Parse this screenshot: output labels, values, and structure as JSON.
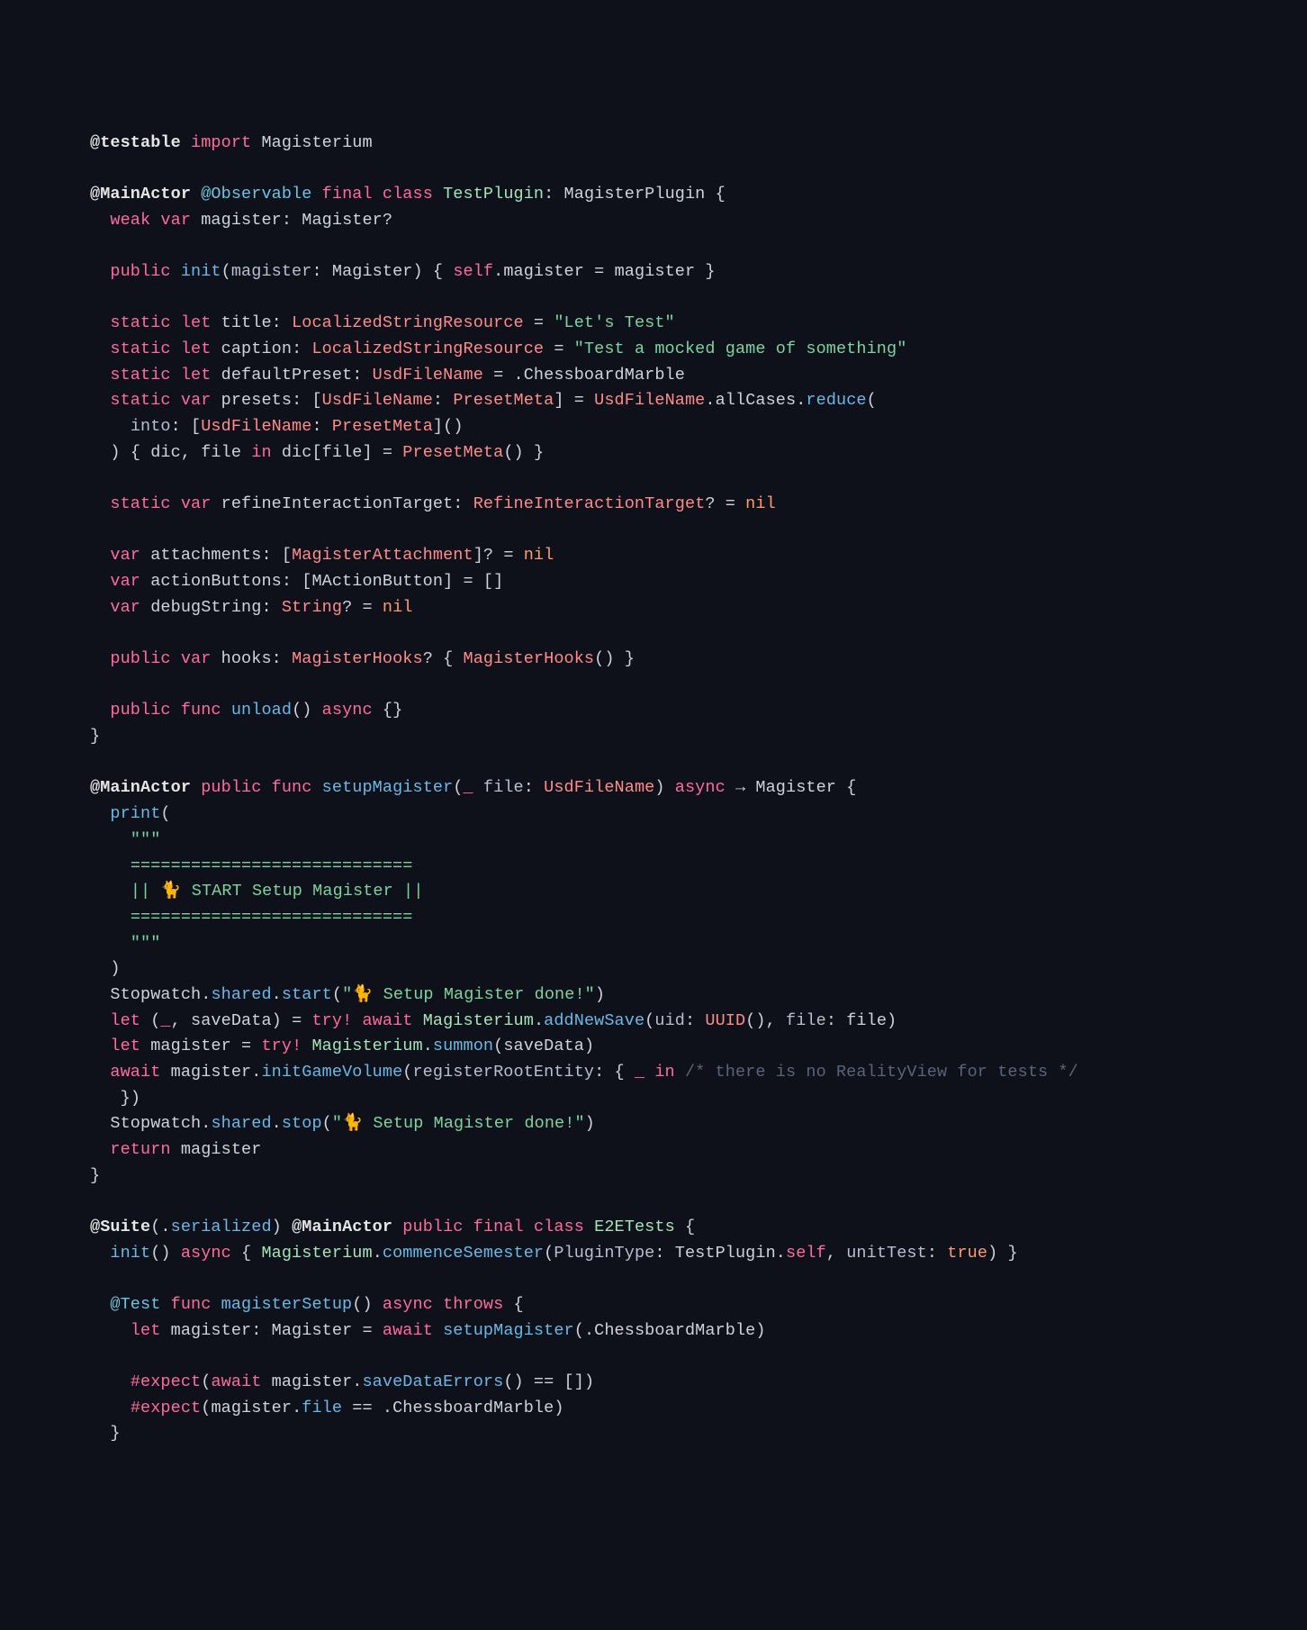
{
  "code": {
    "l1": {
      "a": "@testable",
      "b": "import",
      "c": "Magisterium"
    },
    "l2": {
      "a": "@MainActor",
      "b": "@Observable",
      "c": "final",
      "d": "class",
      "e": "TestPlugin",
      "f": ":",
      "g": "MagisterPlugin",
      "h": "{"
    },
    "l3": {
      "a": "weak",
      "b": "var",
      "c": "magister",
      "d": ":",
      "e": "Magister",
      "f": "?"
    },
    "l4": {
      "a": "public",
      "b": "init",
      "c": "(",
      "d": "magister",
      "e": ":",
      "f": "Magister",
      "g": ")",
      "h": "{",
      "i": "self",
      "j": ".",
      "k": "magister",
      "l": "=",
      "m": "magister",
      "n": "}"
    },
    "l5": {
      "a": "static",
      "b": "let",
      "c": "title",
      "d": ":",
      "e": "LocalizedStringResource",
      "f": "=",
      "g": "\"Let's Test\""
    },
    "l6": {
      "a": "static",
      "b": "let",
      "c": "caption",
      "d": ":",
      "e": "LocalizedStringResource",
      "f": "=",
      "g": "\"Test a mocked game of something\""
    },
    "l7": {
      "a": "static",
      "b": "let",
      "c": "defaultPreset",
      "d": ":",
      "e": "UsdFileName",
      "f": "=",
      "g": ".",
      "h": "ChessboardMarble"
    },
    "l8": {
      "a": "static",
      "b": "var",
      "c": "presets",
      "d": ":",
      "e": "[",
      "f": "UsdFileName",
      "g": ":",
      "h": "PresetMeta",
      "i": "]",
      "j": "=",
      "k": "UsdFileName",
      "l": ".",
      "m": "allCases",
      "n": ".",
      "o": "reduce",
      "p": "("
    },
    "l9": {
      "a": "into",
      "b": ":",
      "c": "[",
      "d": "UsdFileName",
      "e": ":",
      "f": "PresetMeta",
      "g": "]",
      "h": "(",
      "i": ")"
    },
    "l10": {
      "a": ")",
      "b": "{",
      "c": "dic",
      "d": ",",
      "e": "file",
      "f": "in",
      "g": "dic",
      "h": "[",
      "i": "file",
      "j": "]",
      "k": "=",
      "l": "PresetMeta",
      "m": "(",
      "n": ")",
      "o": "}"
    },
    "l11": {
      "a": "static",
      "b": "var",
      "c": "refineInteractionTarget",
      "d": ":",
      "e": "RefineInteractionTarget",
      "f": "?",
      "g": "=",
      "h": "nil"
    },
    "l12": {
      "a": "var",
      "b": "attachments",
      "c": ":",
      "d": "[",
      "e": "MagisterAttachment",
      "f": "]",
      "g": "?",
      "h": "=",
      "i": "nil"
    },
    "l13": {
      "a": "var",
      "b": "actionButtons",
      "c": ":",
      "d": "[",
      "e": "MActionButton",
      "f": "]",
      "g": "=",
      "h": "[",
      "i": "]"
    },
    "l14": {
      "a": "var",
      "b": "debugString",
      "c": ":",
      "d": "String",
      "e": "?",
      "f": "=",
      "g": "nil"
    },
    "l15": {
      "a": "public",
      "b": "var",
      "c": "hooks",
      "d": ":",
      "e": "MagisterHooks",
      "f": "?",
      "g": "{",
      "h": "MagisterHooks",
      "i": "(",
      "j": ")",
      "k": "}"
    },
    "l16": {
      "a": "public",
      "b": "func",
      "c": "unload",
      "d": "(",
      "e": ")",
      "f": "async",
      "g": "{",
      "h": "}"
    },
    "l17": {
      "a": "}"
    },
    "l18": {
      "a": "@MainActor",
      "b": "public",
      "c": "func",
      "d": "setupMagister",
      "e": "(",
      "f": "_",
      "g": "file",
      "h": ":",
      "i": "UsdFileName",
      "j": ")",
      "k": "async",
      "l": "→",
      "m": "Magister",
      "n": "{"
    },
    "l19": {
      "a": "print",
      "b": "("
    },
    "l20": {
      "a": "\"\"\""
    },
    "l21": {
      "a": "============================"
    },
    "l22": {
      "a": "||",
      "b": "🐈",
      "c": "START Setup Magister",
      "d": "||"
    },
    "l23": {
      "a": "============================"
    },
    "l24": {
      "a": "\"\"\""
    },
    "l25": {
      "a": ")"
    },
    "l26": {
      "a": "Stopwatch",
      "b": ".",
      "c": "shared",
      "d": ".",
      "e": "start",
      "f": "(",
      "g": "\"🐈 Setup Magister done!\"",
      "h": ")"
    },
    "l27": {
      "a": "let",
      "b": "(",
      "c": "_",
      "d": ",",
      "e": "saveData",
      "f": ")",
      "g": "=",
      "h": "try",
      "i": "!",
      "j": "await",
      "k": "Magisterium",
      "l": ".",
      "m": "addNewSave",
      "n": "(",
      "o": "uid",
      "p": ":",
      "q": "UUID",
      "r": "(",
      "s": ")",
      "t": ",",
      "u": "file",
      "v": ":",
      "w": "file",
      "x": ")"
    },
    "l28": {
      "a": "let",
      "b": "magister",
      "c": "=",
      "d": "try",
      "e": "!",
      "f": "Magisterium",
      "g": ".",
      "h": "summon",
      "i": "(",
      "j": "saveData",
      "k": ")"
    },
    "l29": {
      "a": "await",
      "b": "magister",
      "c": ".",
      "d": "initGameVolume",
      "e": "(",
      "f": "registerRootEntity",
      "g": ":",
      "h": "{",
      "i": "_",
      "j": "in",
      "k": "/* there is no RealityView for tests */"
    },
    "l30": {
      "a": "}",
      "b": ")"
    },
    "l31": {
      "a": "Stopwatch",
      "b": ".",
      "c": "shared",
      "d": ".",
      "e": "stop",
      "f": "(",
      "g": "\"🐈 Setup Magister done!\"",
      "h": ")"
    },
    "l32": {
      "a": "return",
      "b": "magister"
    },
    "l33": {
      "a": "}"
    },
    "l34": {
      "a": "@Suite",
      "b": "(",
      "c": ".",
      "d": "serialized",
      "e": ")",
      "f": "@MainActor",
      "g": "public",
      "h": "final",
      "i": "class",
      "j": "E2ETests",
      "k": "{"
    },
    "l35": {
      "a": "init",
      "b": "(",
      "c": ")",
      "d": "async",
      "e": "{",
      "f": "Magisterium",
      "g": ".",
      "h": "commenceSemester",
      "i": "(",
      "j": "PluginType",
      "k": ":",
      "l": "TestPlugin",
      "m": ".",
      "n": "self",
      "o": ",",
      "p": "unitTest",
      "q": ":",
      "r": "true",
      "s": ")",
      "t": "}"
    },
    "l36": {
      "a": "@Test",
      "b": "func",
      "c": "magisterSetup",
      "d": "(",
      "e": ")",
      "f": "async",
      "g": "throws",
      "h": "{"
    },
    "l37": {
      "a": "let",
      "b": "magister",
      "c": ":",
      "d": "Magister",
      "e": "=",
      "f": "await",
      "g": "setupMagister",
      "h": "(",
      "i": ".",
      "j": "ChessboardMarble",
      "k": ")"
    },
    "l38": {
      "a": "#expect",
      "b": "(",
      "c": "await",
      "d": "magister",
      "e": ".",
      "f": "saveDataErrors",
      "g": "(",
      "h": ")",
      "i": "==",
      "j": "[",
      "k": "]",
      "l": ")"
    },
    "l39": {
      "a": "#expect",
      "b": "(",
      "c": "magister",
      "d": ".",
      "e": "file",
      "f": "==",
      "g": ".",
      "h": "ChessboardMarble",
      "i": ")"
    },
    "l40": {
      "a": "}"
    }
  }
}
